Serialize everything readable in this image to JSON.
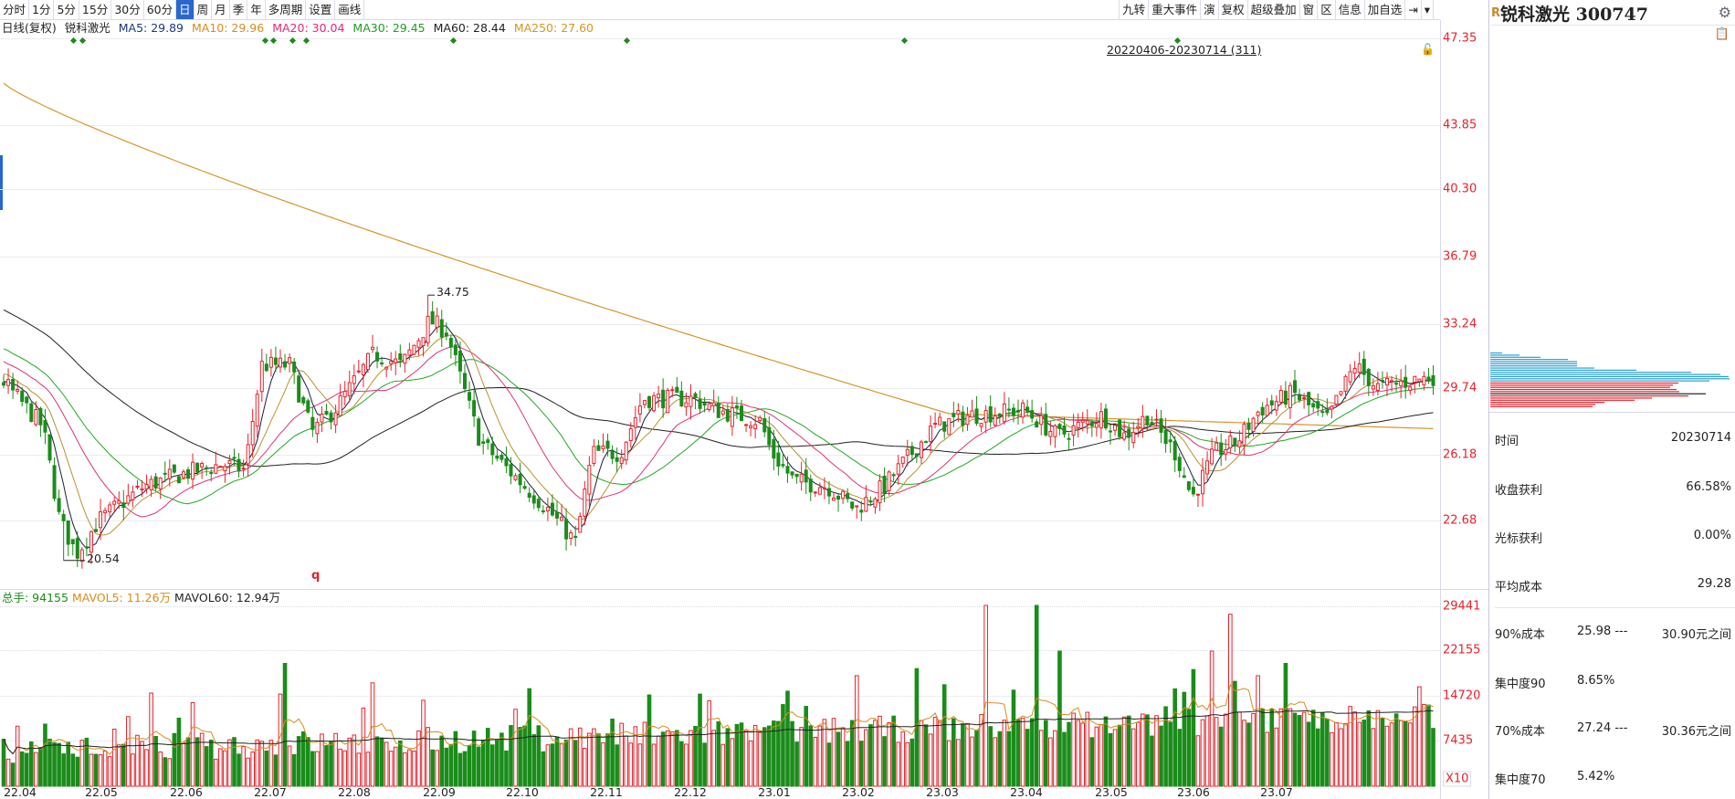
{
  "toolbar_left": [
    "分时",
    "1分",
    "5分",
    "15分",
    "30分",
    "60分",
    "日",
    "周",
    "月",
    "季",
    "年",
    "多周期",
    "设置",
    "画线"
  ],
  "toolbar_active": "日",
  "toolbar_right": [
    "九转",
    "重大事件",
    "演",
    "复权",
    "超级叠加",
    "窗",
    "区",
    "信息",
    "加自选",
    "⇥",
    "▾"
  ],
  "info": {
    "period": "日线(复权)",
    "name": "锐科激光",
    "ma5": "MA5: 29.89",
    "ma10": "MA10: 29.96",
    "ma20": "MA20: 30.04",
    "ma30": "MA30: 29.45",
    "ma60": "MA60: 28.44",
    "ma250": "MA250: 27.60"
  },
  "range_text": "20220406-20230714 (311)",
  "price_axis": [
    "47.35",
    "43.85",
    "40.30",
    "36.79",
    "33.24",
    "29.74",
    "26.18",
    "22.68"
  ],
  "markers": {
    "high": "34.75",
    "low": "20.54",
    "bottom_mark": "q"
  },
  "volume_info": {
    "total": "总手: 94155",
    "mavol5": "MAVOL5: 11.26万",
    "mavol60": "MAVOL60: 12.94万"
  },
  "volume_axis": [
    "29441",
    "22155",
    "14720",
    "7435",
    "X10"
  ],
  "dates": [
    "22.04",
    "22.05",
    "22.06",
    "22.07",
    "22.08",
    "22.09",
    "22.10",
    "22.11",
    "22.12",
    "23.01",
    "23.02",
    "23.03",
    "23.04",
    "23.05",
    "23.06",
    "23.07"
  ],
  "colors": {
    "up": "#e8212a",
    "down": "#1a8c1a",
    "ma5": "#1c1c3c",
    "ma10": "#b8912e",
    "ma20": "#e0307a",
    "ma30": "#21a821",
    "ma60": "#222222",
    "ma250": "#d4962a",
    "chip_upper": "#2a9fd0",
    "chip_lower": "#e8212a"
  },
  "panel": {
    "badge": "R",
    "title": "锐科激光 300747",
    "stats": [
      {
        "label": "时间",
        "value": "20230714"
      },
      {
        "label": "收盘获利",
        "value": "66.58%"
      },
      {
        "label": "光标获利",
        "value": "0.00%"
      },
      {
        "label": "平均成本",
        "value": "29.28"
      }
    ],
    "ranges": [
      {
        "label": "90%成本",
        "low": "25.98 ---",
        "high": "30.90元之间"
      },
      {
        "label": "集中度90",
        "low": "8.65%",
        "high": ""
      },
      {
        "label": "70%成本",
        "low": "27.24 ---",
        "high": "30.36元之间"
      },
      {
        "label": "集中度70",
        "low": "5.42%",
        "high": ""
      }
    ]
  }
}
